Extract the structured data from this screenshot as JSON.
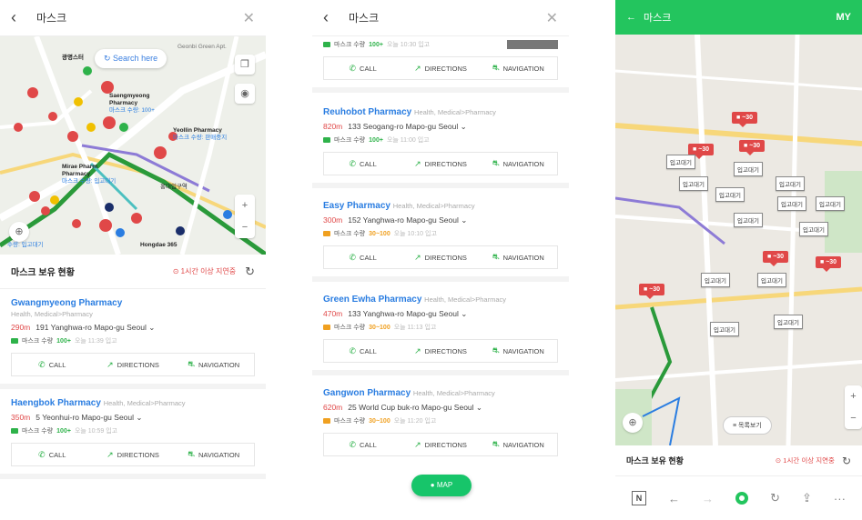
{
  "screen1": {
    "title": "마스크",
    "search_here": "Search here",
    "map_labels": {
      "gwangmyeong": "광명스터",
      "saengmyeong": "Saengmyeong",
      "saengmyeong2": "Pharmacy",
      "saengmyeong_sub": "마스크 수량: 100+",
      "yeollin": "Yeollin Pharmacy",
      "yeollin_sub": "마스크 수량: 판매중지",
      "mirae": "Mirae Pharm",
      "mirae2": "Pharmacy",
      "mirae_sub": "마스크 수량: 입고대기",
      "hongdae": "홍대입구역",
      "hongdae365": "Hongdae 365",
      "geonbi": "Geonbi Green Apt.",
      "bottom_left": "수량: 입고대기"
    },
    "status_title": "마스크 보유 현황",
    "status_delay": "1시간 이상 지연중",
    "cards": [
      {
        "name": "Gwangmyeong Pharmacy",
        "category": "Health, Medical>Pharmacy",
        "distance": "290m",
        "address": "191 Yanghwa-ro Mapo-gu Seoul",
        "stock_label": "마스크 수량",
        "qty": "100+",
        "time": "오늘 11:39 입고",
        "stock_color": "#2eb24a"
      },
      {
        "name": "Haengbok Pharmacy",
        "category": "Health, Medical>Pharmacy",
        "distance": "350m",
        "address": "5 Yeonhui-ro Mapo-gu Seoul",
        "stock_label": "마스크 수량",
        "qty": "100+",
        "time": "오늘 10:59 입고",
        "stock_color": "#2eb24a"
      }
    ],
    "actions": {
      "call": "CALL",
      "directions": "DIRECTIONS",
      "navigation": "NAVIGATION"
    }
  },
  "screen2": {
    "title": "마스크",
    "top_stock": {
      "stock_label": "마스크 수량",
      "qty": "100+",
      "time": "오늘 10:30 입고"
    },
    "cards": [
      {
        "name": "Reuhobot Pharmacy",
        "category": "Health, Medical>Pharmacy",
        "distance": "820m",
        "address": "133 Seogang-ro Mapo-gu Seoul",
        "stock_label": "마스크 수량",
        "qty": "100+",
        "time": "오늘 11:00 입고",
        "stock_color": "#2eb24a"
      },
      {
        "name": "Easy Pharmacy",
        "category": "Health, Medical>Pharmacy",
        "distance": "300m",
        "address": "152 Yanghwa-ro Mapo-gu Seoul",
        "stock_label": "마스크 수량",
        "qty": "30~100",
        "time": "오늘 10:10 입고",
        "stock_color": "#f0a020"
      },
      {
        "name": "Green Ewha Pharmacy",
        "category": "Health, Medical>Pharmacy",
        "distance": "470m",
        "address": "133 Yanghwa-ro Mapo-gu Seoul",
        "stock_label": "마스크 수량",
        "qty": "30~100",
        "time": "오늘 11:13 입고",
        "stock_color": "#f0a020"
      },
      {
        "name": "Gangwon Pharmacy",
        "category": "Health, Medical>Pharmacy",
        "distance": "620m",
        "address": "25 World Cup buk-ro Mapo-gu Seoul",
        "stock_label": "마스크 수량",
        "qty": "30~100",
        "time": "오늘 11:20 입고",
        "stock_color": "#f0a020"
      }
    ],
    "actions": {
      "call": "CALL",
      "directions": "DIRECTIONS",
      "navigation": "NAVIGATION"
    },
    "map_button": "MAP"
  },
  "screen3": {
    "title": "마스크",
    "my": "MY",
    "red_tags": [
      "~30",
      "~30",
      "~30",
      "~30",
      "~30",
      "~30"
    ],
    "waiting_tag": "입고대기",
    "list_button": "목록보기",
    "status_title": "마스크 보유 현황",
    "status_delay": "1시간 이상 지연중",
    "browser": {
      "n": "N",
      "more": "···"
    }
  },
  "colors": {
    "accent_blue": "#2a7de1",
    "distance_red": "#e04848",
    "naver_green": "#23c55e",
    "stock_green": "#2eb24a",
    "stock_orange": "#f0a020"
  }
}
